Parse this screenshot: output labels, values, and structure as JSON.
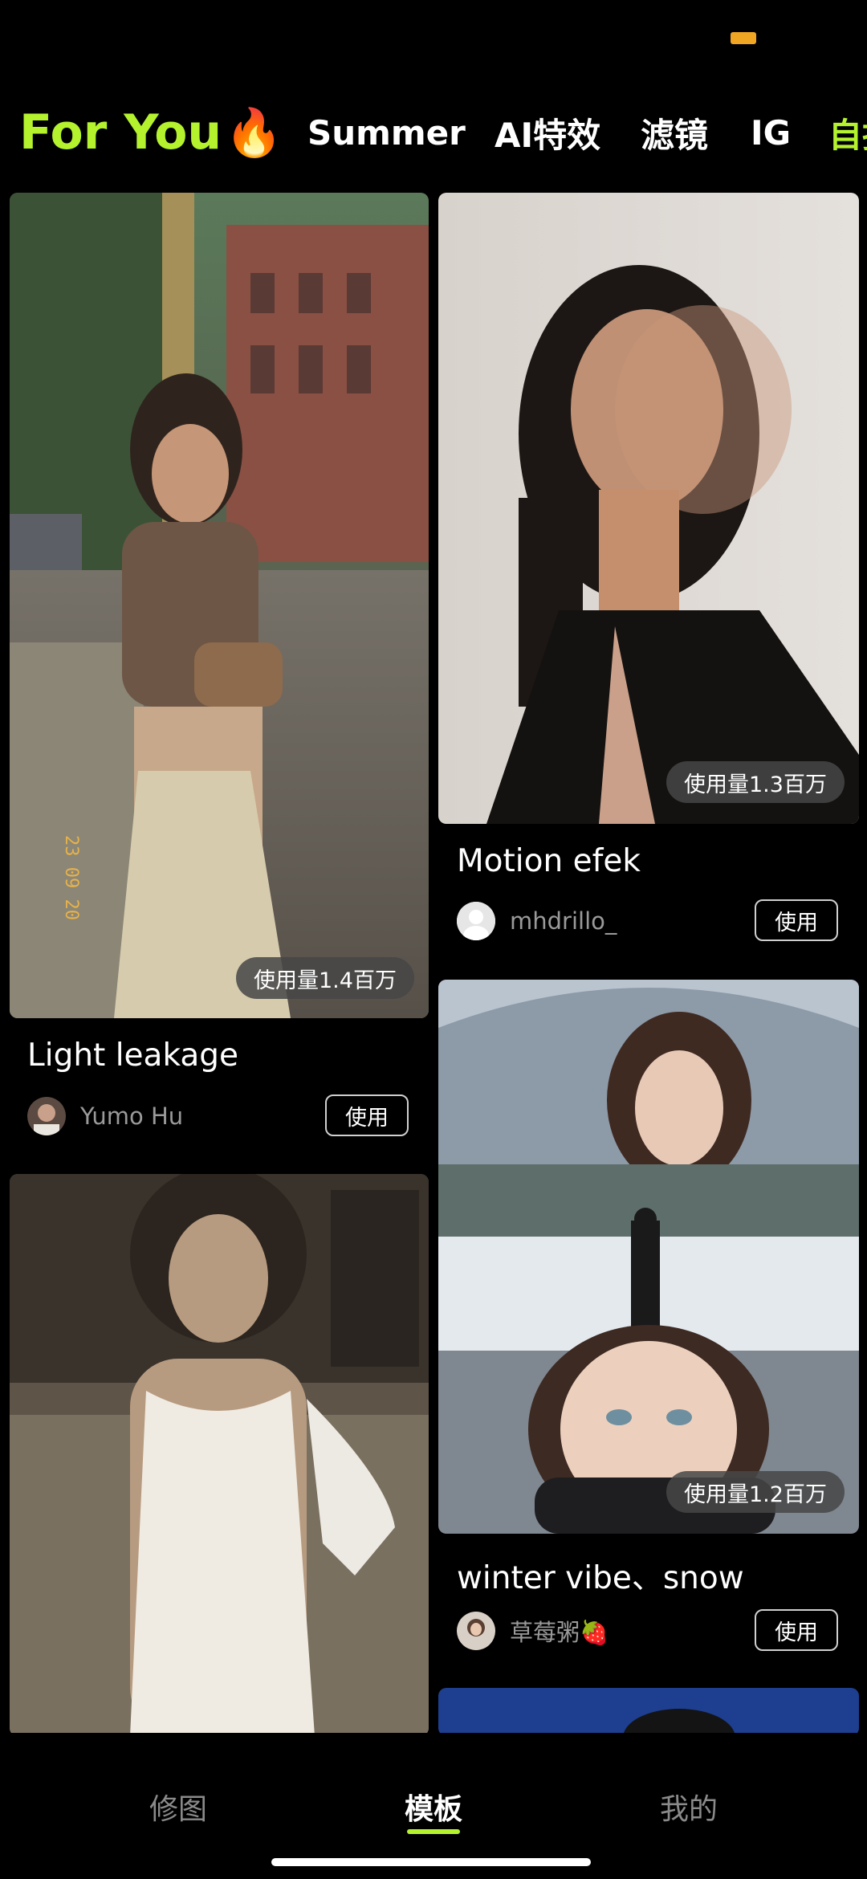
{
  "tabs": [
    {
      "label": "For You",
      "icon": "fire-icon"
    },
    {
      "label": "Summer"
    },
    {
      "label": "AI特效"
    },
    {
      "label": "滤镜"
    },
    {
      "label": "IG"
    },
    {
      "label": "自拍"
    }
  ],
  "accent_color": "#b4f22e",
  "cards": [
    {
      "title": "Light leakage",
      "author": "Yumo Hu",
      "usage": "使用量1.4百万",
      "use_label": "使用"
    },
    {
      "title": "Motion efek",
      "author": "mhdrillo_",
      "usage": "使用量1.3百万",
      "use_label": "使用"
    },
    {
      "title": "winter vibe、snow",
      "author": "草莓粥🍓",
      "usage": "使用量1.2百万",
      "use_label": "使用"
    }
  ],
  "bottom_nav": {
    "items": [
      "修图",
      "模板",
      "我的"
    ],
    "active_index": 1
  }
}
